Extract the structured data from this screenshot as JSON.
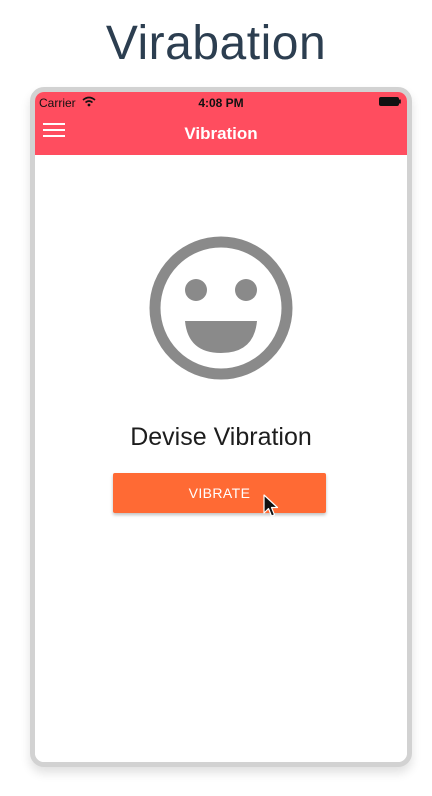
{
  "page": {
    "title": "Virabation"
  },
  "status_bar": {
    "carrier": "Carrier",
    "time": "4:08 PM",
    "icons": [
      "wifi-icon",
      "battery-icon"
    ]
  },
  "nav_bar": {
    "title": "Vibration",
    "menu_icon": "menu-icon",
    "background_color": "#ff4d5f"
  },
  "main": {
    "icon": "smiley-icon",
    "heading": "Devise Vibration",
    "button_label": "VIBRATE",
    "button_color": "#ff6a34"
  }
}
